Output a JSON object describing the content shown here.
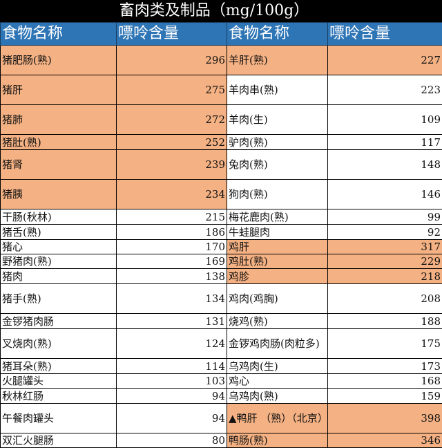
{
  "title": "畜肉类及制品（mg/100g）",
  "headers": [
    "食物名称",
    "嘌呤含量",
    "食物名称",
    "嘌呤含量"
  ],
  "colors": {
    "header": "#2E75B6",
    "highlight": "#F4B183"
  },
  "rows": [
    {
      "l_name": "猪肥肠(熟)",
      "l_val": "296",
      "l_hl": true,
      "r_name": "羊肝(熟)",
      "r_val": "227",
      "r_hl": true
    },
    {
      "l_name": "猪肝",
      "l_val": "275",
      "l_hl": true,
      "r_name": "羊肉串(熟)",
      "r_val": "223",
      "r_hl": false
    },
    {
      "l_name": "猪肺",
      "l_val": "272",
      "l_hl": true,
      "r_name": "羊肉(生)",
      "r_val": "109",
      "r_hl": false
    },
    {
      "l_name": "猪肚(熟)",
      "l_val": "252",
      "l_hl": true,
      "r_name": "驴肉(熟)",
      "r_val": "117",
      "r_hl": false
    },
    {
      "l_name": "猪肾",
      "l_val": "239",
      "l_hl": true,
      "r_name": "兔肉(熟)",
      "r_val": "148",
      "r_hl": false
    },
    {
      "l_name": "猪胰",
      "l_val": "234",
      "l_hl": true,
      "r_name": "狗肉(熟)",
      "r_val": "146",
      "r_hl": false
    },
    {
      "l_name": "干肠(秋林)",
      "l_val": "215",
      "l_hl": false,
      "r_name": "梅花鹿肉(熟)",
      "r_val": "99",
      "r_hl": false
    },
    {
      "l_name": "猪舌(熟)",
      "l_val": "186",
      "l_hl": false,
      "r_name": "牛蛙腿肉",
      "r_val": "92",
      "r_hl": false
    },
    {
      "l_name": "猪心",
      "l_val": "170",
      "l_hl": false,
      "r_name": "鸡肝",
      "r_val": "317",
      "r_hl": true
    },
    {
      "l_name": "野猪肉(熟)",
      "l_val": "169",
      "l_hl": false,
      "r_name": "鸡肚(熟)",
      "r_val": "229",
      "r_hl": true
    },
    {
      "l_name": "猪肉",
      "l_val": "138",
      "l_hl": false,
      "r_name": "鸡胗",
      "r_val": "218",
      "r_hl": true
    },
    {
      "l_name": "猪手(熟)",
      "l_val": "134",
      "l_hl": false,
      "r_name": "鸡肉(鸡胸)",
      "r_val": "208",
      "r_hl": false
    },
    {
      "l_name": "金锣猪肉肠",
      "l_val": "131",
      "l_hl": false,
      "r_name": "烧鸡(熟)",
      "r_val": "188",
      "r_hl": false
    },
    {
      "l_name": "叉烧肉(熟)",
      "l_val": "124",
      "l_hl": false,
      "r_name": "金锣鸡肉肠(肉粒多)",
      "r_val": "175",
      "r_hl": false
    },
    {
      "l_name": "猪耳朵(熟)",
      "l_val": "114",
      "l_hl": false,
      "r_name": "乌鸡肉(生)",
      "r_val": "173",
      "r_hl": false
    },
    {
      "l_name": "火腿罐头",
      "l_val": "103",
      "l_hl": false,
      "r_name": "鸡心",
      "r_val": "168",
      "r_hl": false
    },
    {
      "l_name": "秋林红肠",
      "l_val": "94",
      "l_hl": false,
      "r_name": "乌鸡肉(熟)",
      "r_val": "159",
      "r_hl": false
    },
    {
      "l_name": "午餐肉罐头",
      "l_val": "94",
      "l_hl": false,
      "r_name": "▲鸭肝 （熟）（北京）",
      "r_val": "398",
      "r_hl": true
    },
    {
      "l_name": "双汇火腿肠",
      "l_val": "80",
      "l_hl": false,
      "r_name": "鸭肠(熟)",
      "r_val": "346",
      "r_hl": true
    }
  ]
}
